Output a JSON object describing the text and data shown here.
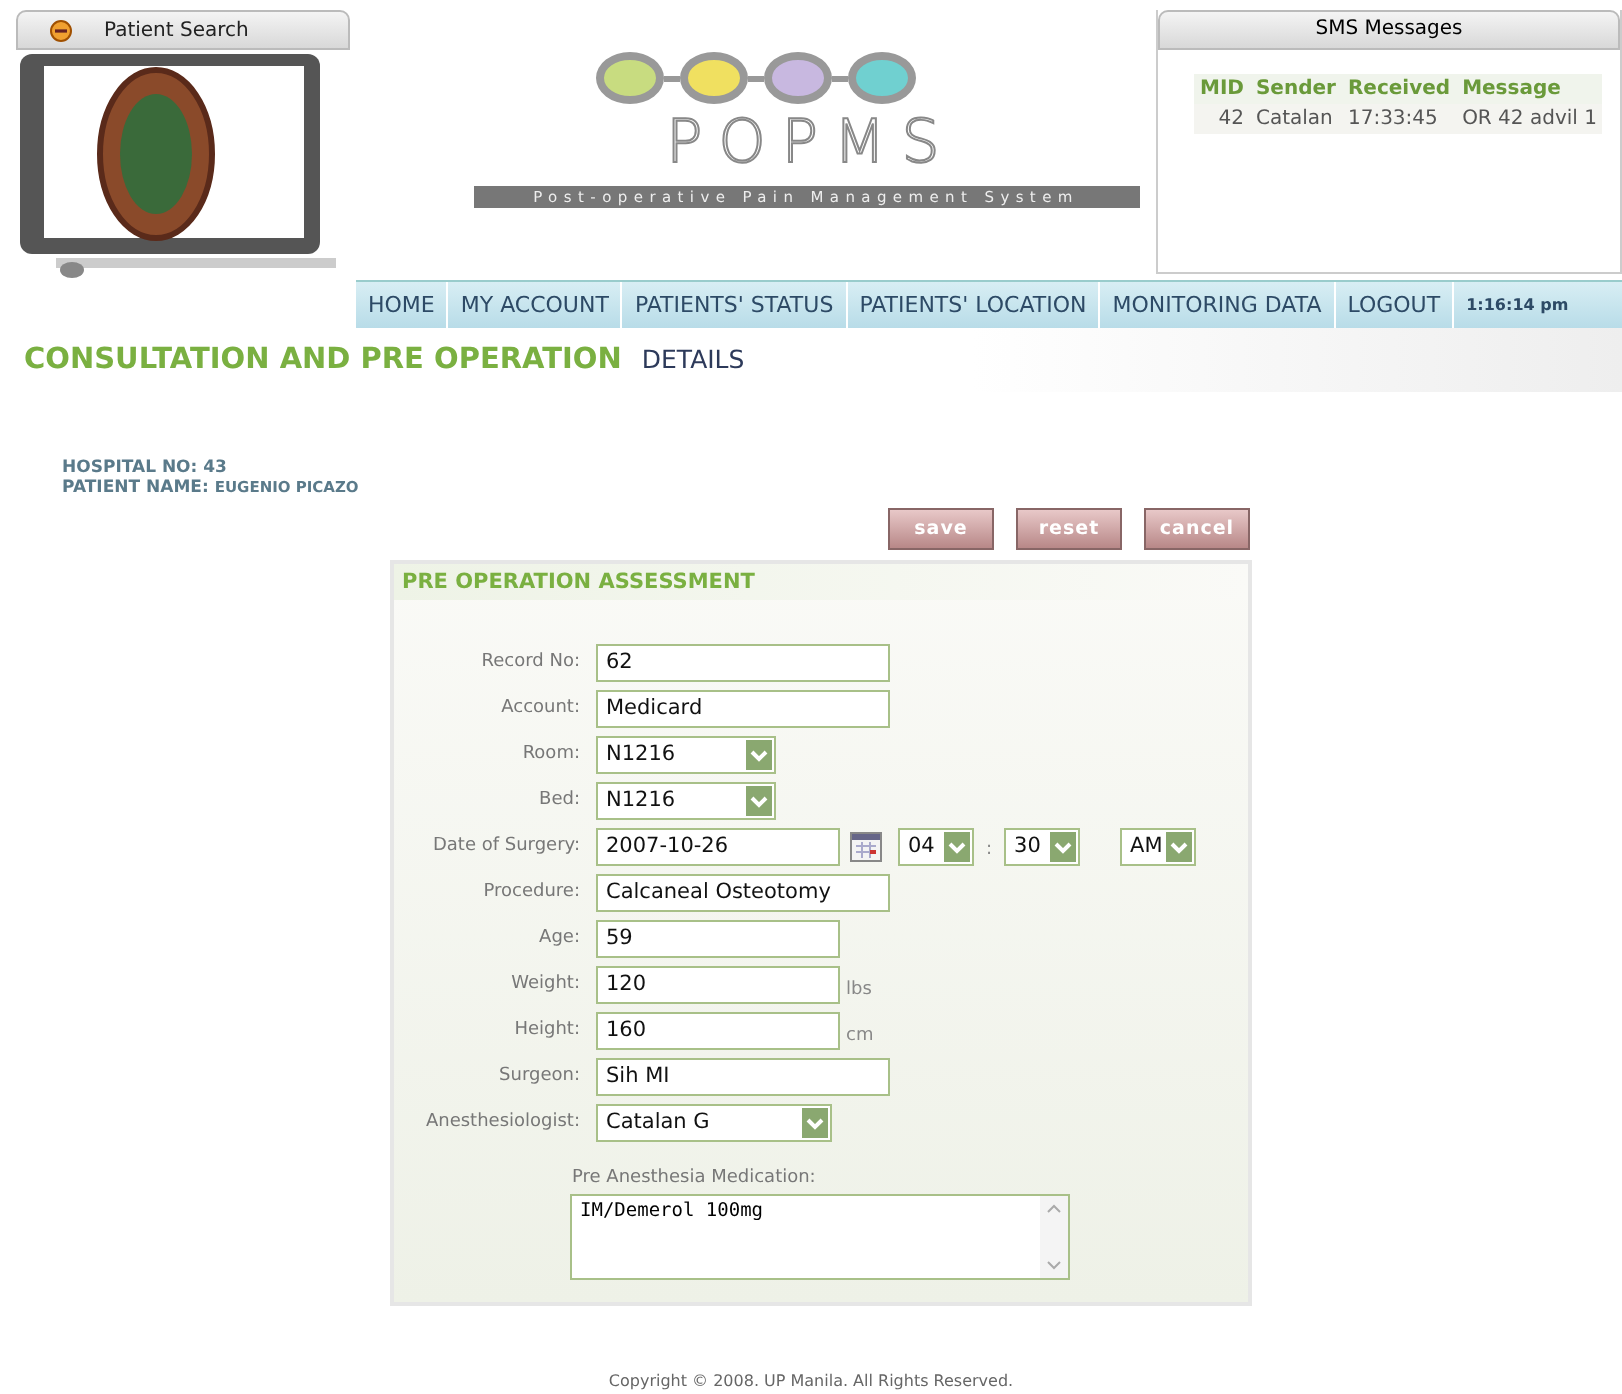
{
  "patient_search": {
    "title": "Patient Search"
  },
  "logo": {
    "name": "POPMS",
    "tagline": "Post-operative Pain Management System"
  },
  "sms": {
    "title": "SMS Messages",
    "columns": [
      "MID",
      "Sender",
      "Received",
      "Message"
    ],
    "rows": [
      [
        "42",
        "Catalan",
        "17:33:45",
        "OR 42 advil 1"
      ]
    ]
  },
  "nav": {
    "items": [
      "HOME",
      "MY ACCOUNT",
      "PATIENTS' STATUS",
      "PATIENTS' LOCATION",
      "MONITORING DATA",
      "LOGOUT"
    ],
    "clock": "1:16:14 pm"
  },
  "page_title": {
    "main": "CONSULTATION AND PRE OPERATION",
    "sub": "DETAILS"
  },
  "patient": {
    "hospital_no": "HOSPITAL NO: 43",
    "name_label": "PATIENT NAME:",
    "name": "EUGENIO PICAZO"
  },
  "buttons": [
    "save",
    "reset",
    "cancel"
  ],
  "form": {
    "title": "PRE OPERATION ASSESSMENT",
    "fields": [
      {
        "kind": "text",
        "label": "Record No:",
        "value": "62"
      },
      {
        "kind": "text",
        "label": "Account:",
        "value": "Medicard"
      },
      {
        "kind": "select",
        "label": "Room:",
        "value": "N1216"
      },
      {
        "kind": "select",
        "label": "Bed:",
        "value": "N1216"
      },
      {
        "kind": "datetime",
        "label": "Date of Surgery:",
        "value": "2007-10-26",
        "hour": "04",
        "separator": ":",
        "minute": "30",
        "ampm": "AM"
      },
      {
        "kind": "text",
        "label": "Procedure:",
        "value": "Calcaneal Osteotomy"
      },
      {
        "kind": "number",
        "label": "Age:",
        "value": "59"
      },
      {
        "kind": "number",
        "label": "Weight:",
        "value": "120",
        "unit": "lbs"
      },
      {
        "kind": "number",
        "label": "Height:",
        "value": "160",
        "unit": "cm"
      },
      {
        "kind": "text",
        "label": "Surgeon:",
        "value": "Sih MI"
      },
      {
        "kind": "wide-select",
        "label": "Anesthesiologist:",
        "value": "Catalan G"
      }
    ],
    "medication": {
      "label": "Pre Anesthesia Medication:",
      "value": "IM/Demerol 100mg"
    }
  },
  "footer": "Copyright © 2008. UP Manila. All Rights Reserved."
}
